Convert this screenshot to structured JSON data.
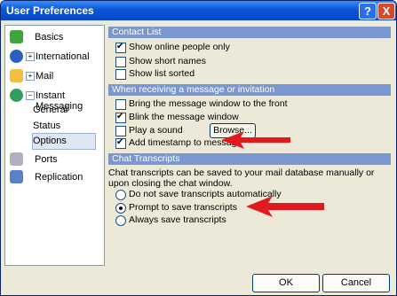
{
  "window": {
    "title": "User Preferences"
  },
  "titlebar": {
    "help_label": "?",
    "close_label": "X"
  },
  "sidebar": {
    "items": [
      {
        "label": "Basics"
      },
      {
        "label": "International"
      },
      {
        "label": "Mail"
      },
      {
        "label": "Instant Messaging"
      },
      {
        "label": "General"
      },
      {
        "label": "Status"
      },
      {
        "label": "Options"
      },
      {
        "label": "Ports"
      },
      {
        "label": "Replication"
      }
    ]
  },
  "contact_list": {
    "header": "Contact List",
    "options": [
      {
        "label": "Show online people only",
        "checked": true
      },
      {
        "label": "Show short names",
        "checked": false
      },
      {
        "label": "Show list sorted",
        "checked": false
      }
    ]
  },
  "receiving": {
    "header": "When receiving a message or invitation",
    "options": [
      {
        "label": "Bring the message window to the front",
        "checked": false
      },
      {
        "label": "Blink the message window",
        "checked": true
      },
      {
        "label": "Play a sound",
        "checked": false
      },
      {
        "label": "Add timestamp to message",
        "checked": true
      }
    ],
    "browse_label": "Browse..."
  },
  "transcripts": {
    "header": "Chat Transcripts",
    "description": "Chat transcripts can be saved to your mail database manually or upon closing the chat window.",
    "options": [
      {
        "label": "Do not save transcripts automatically",
        "selected": false
      },
      {
        "label": "Prompt to save transcripts",
        "selected": true
      },
      {
        "label": "Always save transcripts",
        "selected": false
      }
    ]
  },
  "footer": {
    "ok_label": "OK",
    "cancel_label": "Cancel"
  },
  "colors": {
    "title_bar": "#0a56d8",
    "section_header": "#7b97d0",
    "arrow": "#e2191f"
  }
}
